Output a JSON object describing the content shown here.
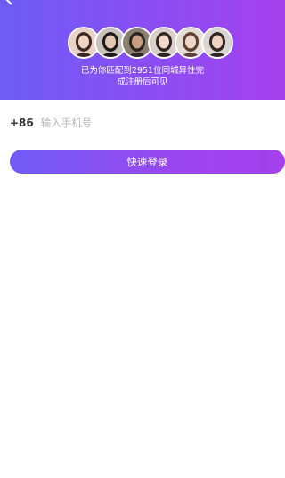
{
  "header": {
    "match_line1": "已为你匹配到2951位同城异性完",
    "match_line2": "成注册后可见",
    "avatars": [
      {
        "bg": "#e9d3c6",
        "hair": "#3b2a22",
        "skin": "#f1d5c4"
      },
      {
        "bg": "#c7c2bc",
        "hair": "#1e1a18",
        "skin": "#e6c7b1"
      },
      {
        "bg": "#8a7f6f",
        "hair": "#2a2320",
        "skin": "#c99f83"
      },
      {
        "bg": "#d8cfc8",
        "hair": "#2e2421",
        "skin": "#f2d8c9"
      },
      {
        "bg": "#e3ddd6",
        "hair": "#5b4033",
        "skin": "#f0d6c6"
      },
      {
        "bg": "#dcd6d2",
        "hair": "#2f2622",
        "skin": "#efd3c2"
      }
    ]
  },
  "form": {
    "country_code": "+86",
    "phone_placeholder": "输入手机号",
    "phone_value": ""
  },
  "login_button": "快速登录"
}
